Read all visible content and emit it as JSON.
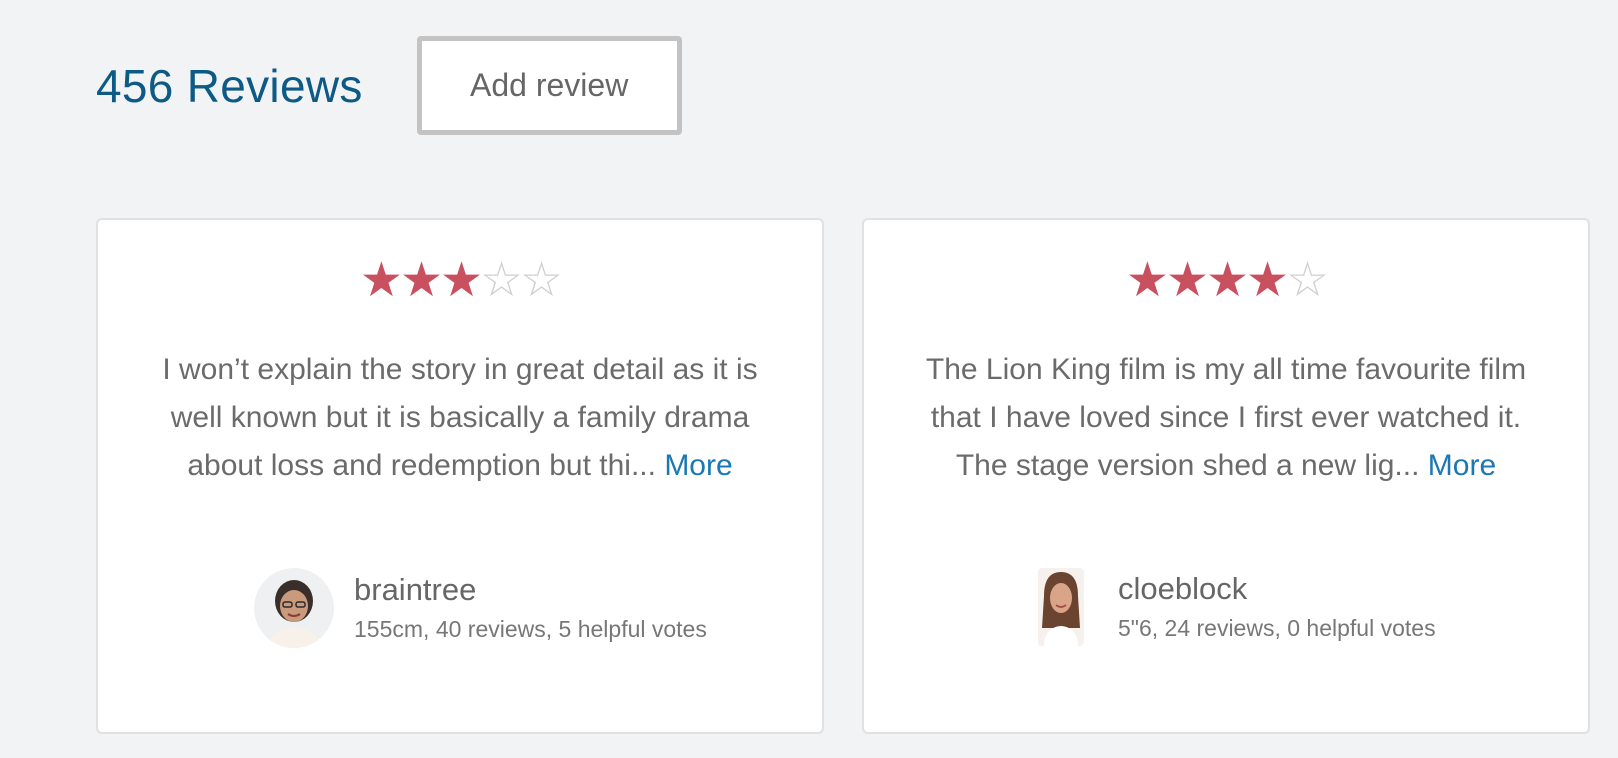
{
  "header": {
    "title": "456 Reviews",
    "add_review_label": "Add review"
  },
  "reviews": [
    {
      "rating": 3,
      "max_rating": 5,
      "text": "I won’t explain the story in great detail as it is well known but it is basically a family drama about loss and redemption but thi...",
      "more_label": "More",
      "author": {
        "name": "braintree",
        "meta": "155cm, 40 reviews, 5 helpful votes"
      }
    },
    {
      "rating": 4,
      "max_rating": 5,
      "text": "The Lion King film is my all time favourite film that I have loved since I first ever watched it. The stage version shed a new lig...",
      "more_label": "More",
      "author": {
        "name": "cloeblock",
        "meta": "5\"6, 24 reviews, 0 helpful votes"
      }
    }
  ],
  "colors": {
    "title": "#0d5a86",
    "star_filled": "#c9515f",
    "star_empty": "#d0d0d0",
    "link": "#1a78b3",
    "background": "#f2f3f5"
  }
}
